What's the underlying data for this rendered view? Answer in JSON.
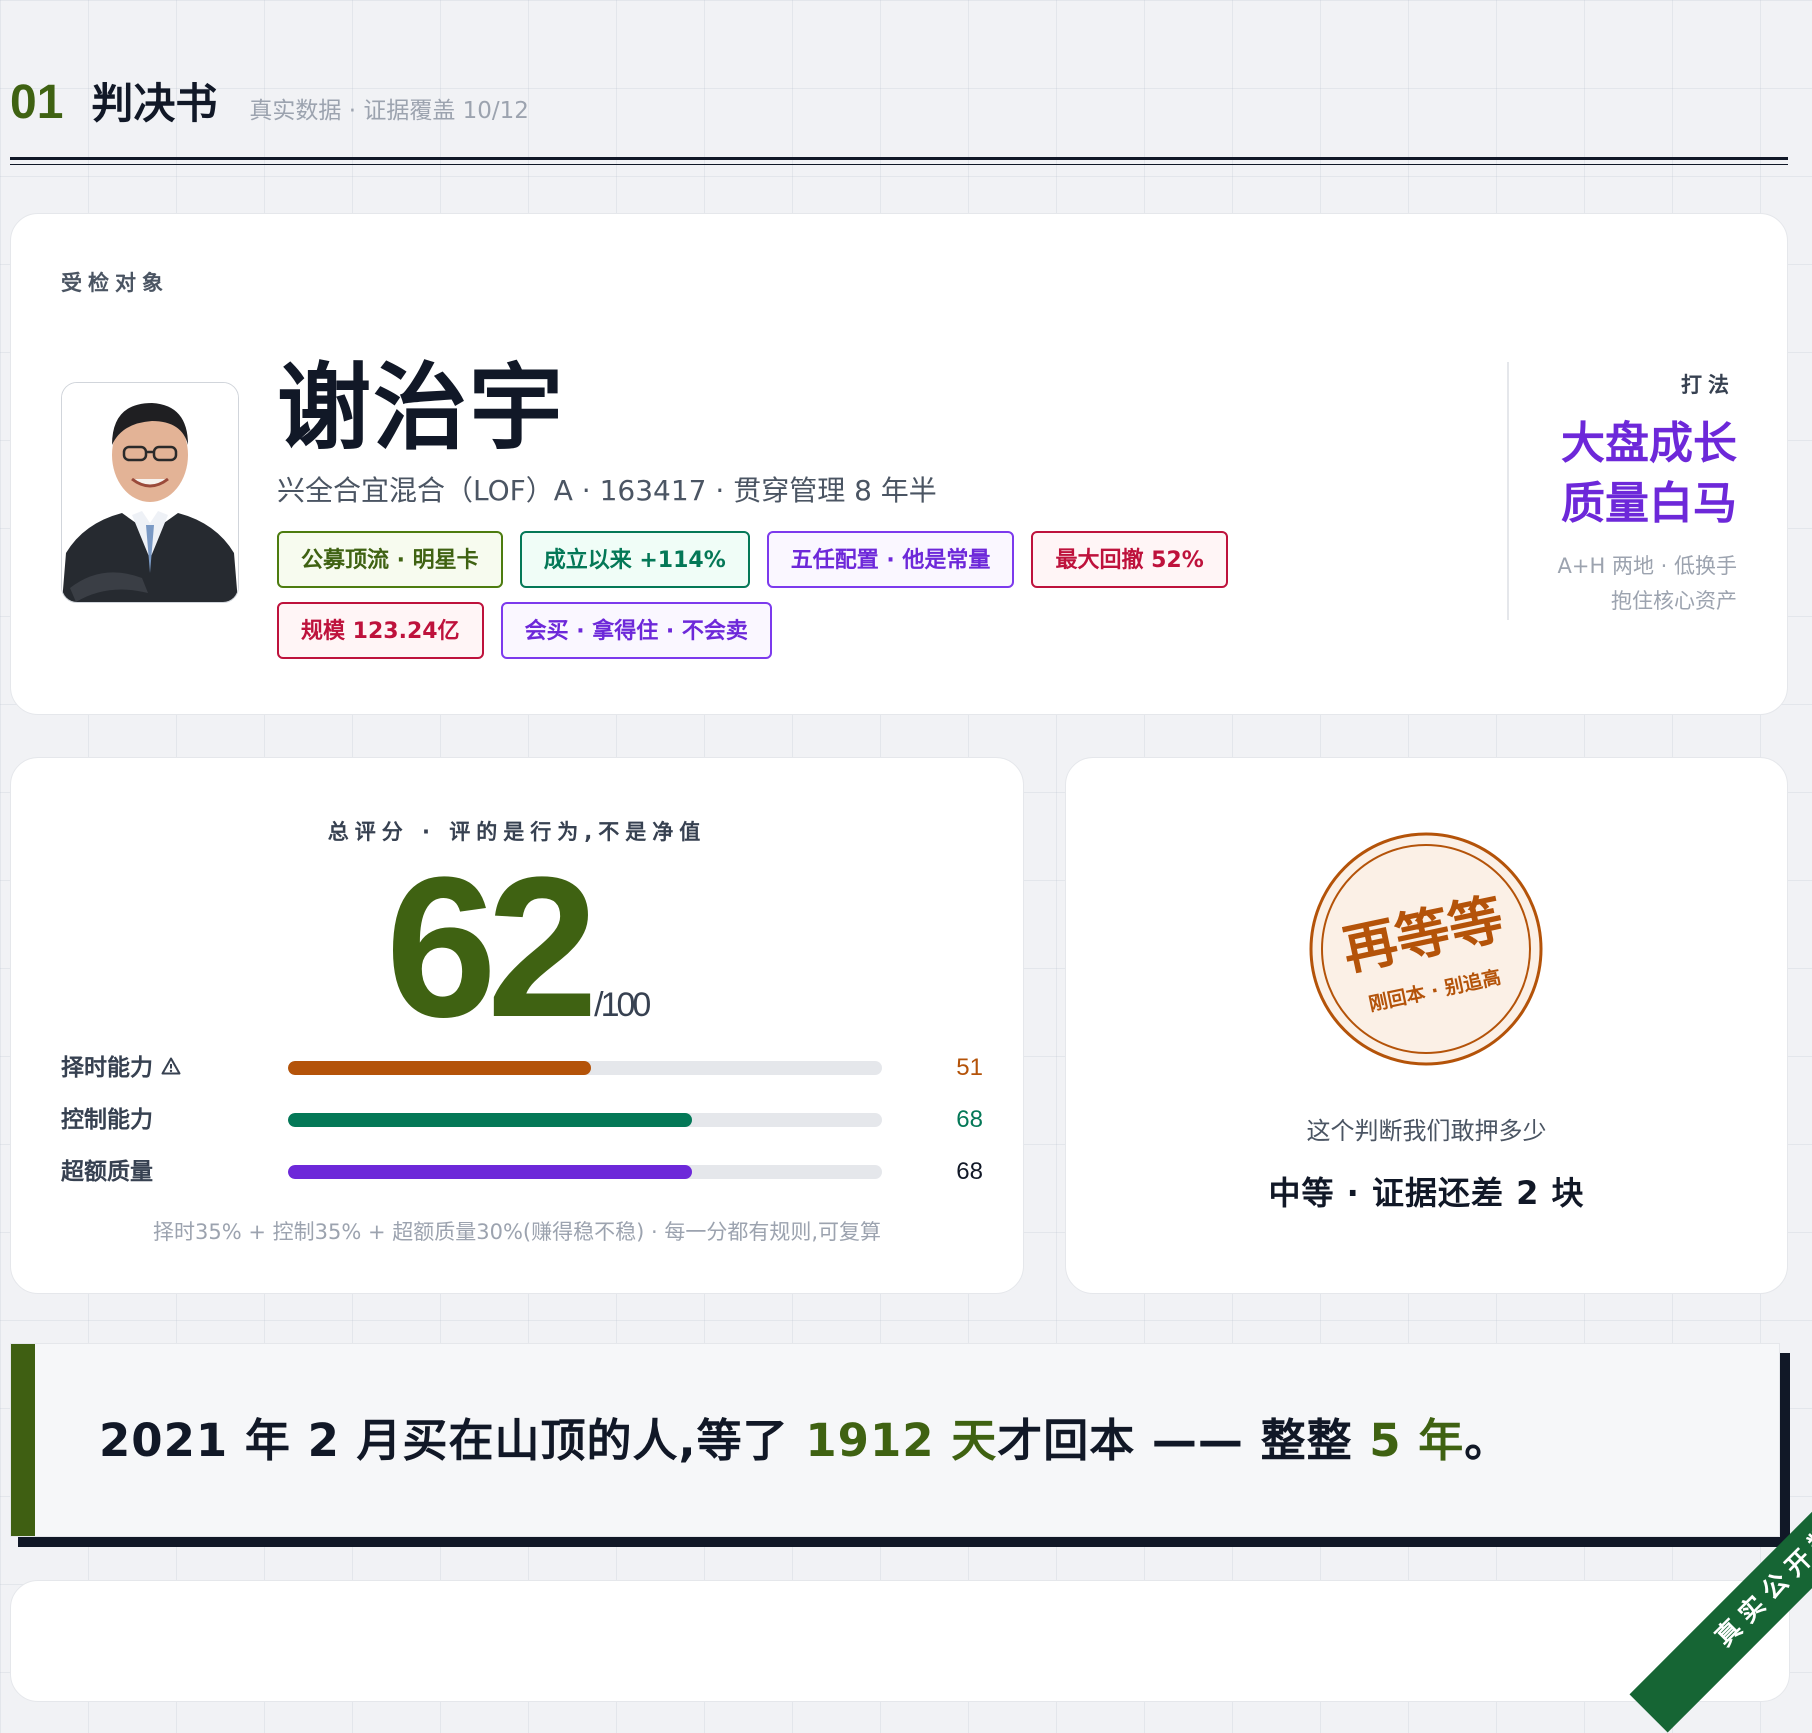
{
  "section": {
    "number": "01",
    "title": "判决书",
    "subtitle": "真实数据 · 证据覆盖 10/12"
  },
  "subject": {
    "label": "受检对象",
    "name": "谢治宇",
    "fund_line": "兴全合宜混合（LOF）A · 163417 · 贯穿管理 8 年半",
    "tags": [
      {
        "text": "公募顶流 · 明星卡",
        "tone": "olive"
      },
      {
        "text": "成立以来 +114%",
        "tone": "green"
      },
      {
        "text": "五任配置 · 他是常量",
        "tone": "purple"
      },
      {
        "text": "最大回撤 52%",
        "tone": "red"
      },
      {
        "text": "规模 123.24亿",
        "tone": "red"
      },
      {
        "text": "会买 · 拿得住 · 不会卖",
        "tone": "purple"
      }
    ],
    "style_label": "打法",
    "style_line1": "大盘成长",
    "style_line2": "质量白马",
    "style_note1": "A+H 两地 · 低换手",
    "style_note2": "抱住核心资产"
  },
  "score": {
    "label": "总评分 · 评的是行为,不是净值",
    "value": "62",
    "max": "/100",
    "bars": [
      {
        "label": "择时能力",
        "value": 51,
        "display": "51",
        "color": "#b45309",
        "warn": true
      },
      {
        "label": "控制能力",
        "value": 68,
        "display": "68",
        "color": "#047857",
        "warn": false
      },
      {
        "label": "超额质量",
        "value": 68,
        "display": "68",
        "color": "#6d28d9",
        "warn": false
      }
    ],
    "formula": "择时35% + 控制35% + 超额质量30%(赚得稳不稳) · 每一分都有规则,可复算"
  },
  "verdict": {
    "stamp_main": "再等等",
    "stamp_sub": "刚回本 · 别追高",
    "confidence_question": "这个判断我们敢押多少",
    "confidence_answer": "中等 · 证据还差 2 块",
    "stamp_color": "#b45309"
  },
  "quote": {
    "part1": "2021 年 2 月买在山顶的人,等了 ",
    "hl1": "1912 天",
    "part2": "才回本 —— 整整 ",
    "hl2": "5 年",
    "part3": "。"
  },
  "ribbon": {
    "text": "真实公开数据"
  }
}
